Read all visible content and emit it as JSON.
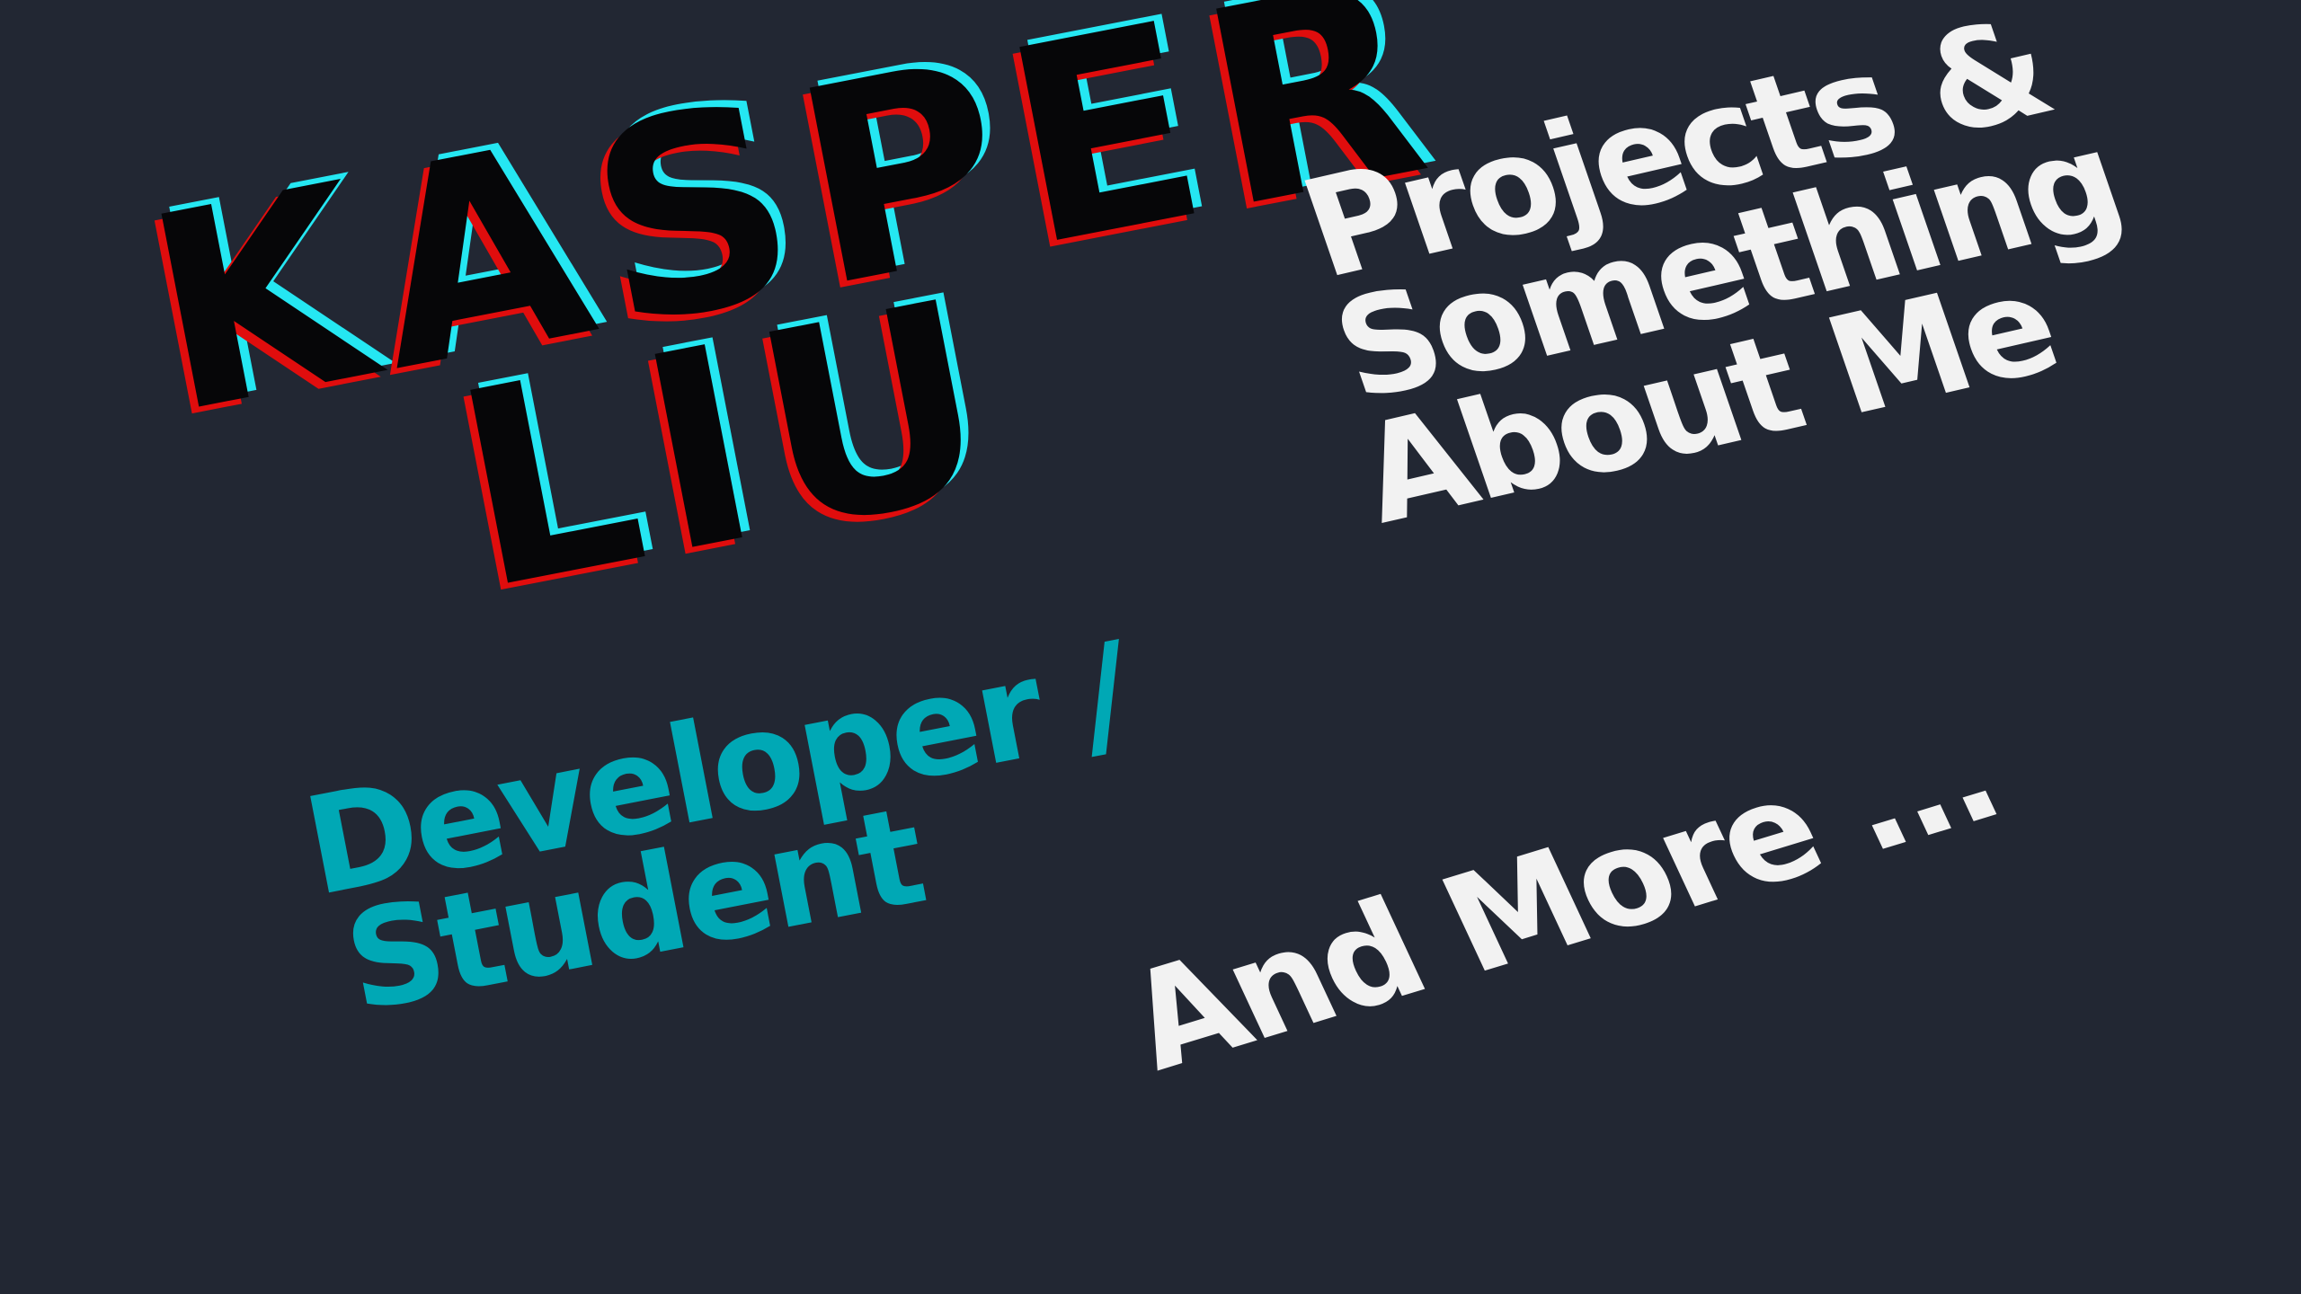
{
  "name": {
    "line1": "KASPER",
    "line2": "LIU"
  },
  "role": {
    "line1": "Developer /",
    "line2": "Student"
  },
  "projects": {
    "line1": "Projects &",
    "line2": "Something",
    "line3": "About Me"
  },
  "more": {
    "text": "And More ..."
  },
  "colors": {
    "background": "#222733",
    "name_fill": "#060608",
    "glitch_red": "#e00d0d",
    "glitch_cyan": "#25e7f2",
    "role": "#00a8b5",
    "projects": "#f2f2f2"
  }
}
